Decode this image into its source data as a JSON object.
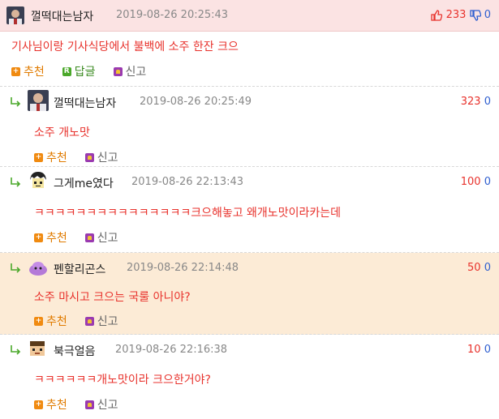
{
  "main": {
    "nickname": "껄떡대는남자",
    "date": "2019-08-26 20:25:43",
    "up": "233",
    "down": "0",
    "text": "기사님이랑 기사식당에서 불백에 소주 한잔 크으",
    "actions": {
      "recommend": "추천",
      "reply": "답글",
      "report": "신고"
    },
    "reply_icon_letter": "R"
  },
  "replies": [
    {
      "nickname": "껄떡대는남자",
      "date": "2019-08-26 20:25:49",
      "up": "323",
      "down": "0",
      "text": "소주 개노맛",
      "recommend": "추천",
      "report": "신고"
    },
    {
      "nickname": "그게me였다",
      "date": "2019-08-26 22:13:43",
      "up": "100",
      "down": "0",
      "text": "ㅋㅋㅋㅋㅋㅋㅋㅋㅋㅋㅋㅋㅋㅋㅋ크으해놓고 왜개노맛이라카는데",
      "recommend": "추천",
      "report": "신고"
    },
    {
      "nickname": "펜할리곤스",
      "date": "2019-08-26 22:14:48",
      "up": "50",
      "down": "0",
      "text": "소주 마시고 크으는 국룰 아니야?",
      "recommend": "추천",
      "report": "신고"
    },
    {
      "nickname": "북극얼음",
      "date": "2019-08-26 22:16:38",
      "up": "10",
      "down": "0",
      "text": "ㅋㅋㅋㅋㅋㅋ개노맛이라 크으한거야?",
      "recommend": "추천",
      "report": "신고"
    }
  ],
  "colors": {
    "up": "#e8322c",
    "down": "#2f5fd0",
    "highlight": "#fcebd6",
    "header": "#fbe3e3"
  }
}
